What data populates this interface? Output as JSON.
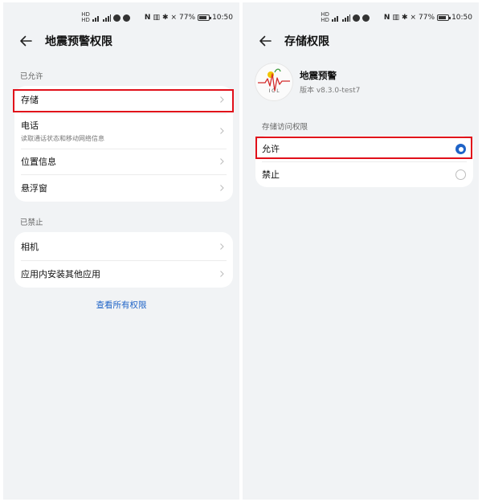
{
  "status_bar": {
    "battery": "77%",
    "time": "10:50"
  },
  "left": {
    "title": "地震预警权限",
    "allowed_label": "已允许",
    "allowed_items": [
      {
        "title": "存储"
      },
      {
        "title": "电话",
        "subtitle": "读取通话状态和移动网络信息"
      },
      {
        "title": "位置信息"
      },
      {
        "title": "悬浮窗"
      }
    ],
    "denied_label": "已禁止",
    "denied_items": [
      {
        "title": "相机"
      },
      {
        "title": "应用内安装其他应用"
      }
    ],
    "view_all": "查看所有权限"
  },
  "right": {
    "title": "存储权限",
    "app_name": "地震预警",
    "app_version": "版本 v8.3.0-test7",
    "logo_letters": "I C L",
    "section_label": "存储访问权限",
    "options": [
      {
        "label": "允许",
        "selected": true
      },
      {
        "label": "禁止",
        "selected": false
      }
    ]
  },
  "colors": {
    "accent": "#1e63c7",
    "highlight": "#e1101a",
    "background": "#f1f3f5"
  }
}
